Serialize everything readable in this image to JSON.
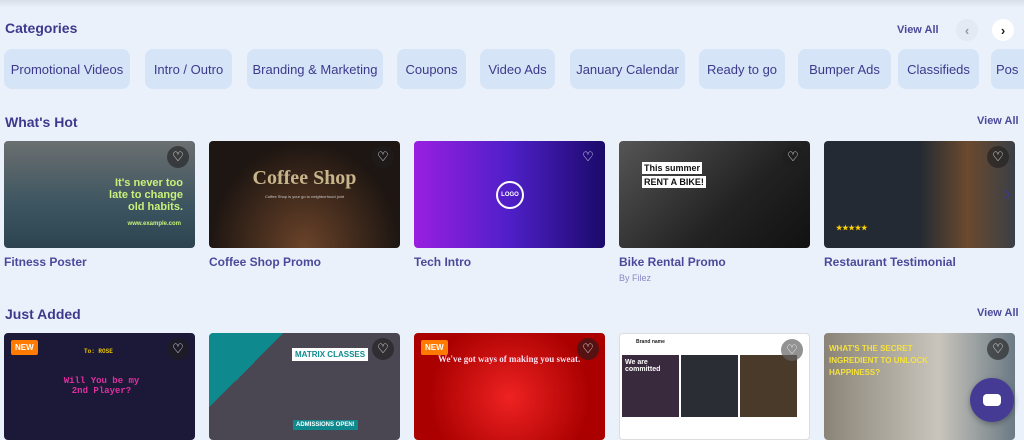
{
  "categories": {
    "title": "Categories",
    "view_all": "View All",
    "prev": "‹",
    "next": "›",
    "items": [
      "Promotional Videos",
      "Intro / Outro",
      "Branding & Marketing",
      "Coupons",
      "Video Ads",
      "January Calendar",
      "Ready to go",
      "Bumper Ads",
      "Classifieds",
      "Pos"
    ]
  },
  "whats_hot": {
    "title": "What's Hot",
    "view_all": "View All",
    "next": "›",
    "cards": [
      {
        "title": "Fitness Poster",
        "overlay": "It's never too late to change old habits.",
        "sub": "www.example.com"
      },
      {
        "title": "Coffee Shop Promo",
        "overlay": "Coffee Shop",
        "sub": "Coffee Shop is your go to neighborhood joint"
      },
      {
        "title": "Tech Intro",
        "overlay": "LOGO"
      },
      {
        "title": "Bike Rental Promo",
        "by": "By Filez",
        "overlay": "This summer",
        "overlay2": "RENT A BIKE!"
      },
      {
        "title": "Restaurant Testimonial",
        "overlay": "★★★★★"
      }
    ]
  },
  "just_added": {
    "title": "Just Added",
    "view_all": "View All",
    "badge": "NEW",
    "cards": [
      {
        "overlay": "Will You be my 2nd Player?",
        "sub": "To: ROSE"
      },
      {
        "overlay": "MATRIX CLASSES",
        "sub": "ADMISSIONS OPEN!"
      },
      {
        "overlay": "We've got ways of making you sweat."
      },
      {
        "overlay": "Brand name",
        "sub": "We are committed"
      },
      {
        "overlay": "WHAT'S THE SECRET INGREDIENT TO UNLOCK HAPPINESS?"
      }
    ]
  },
  "heart": "♡"
}
